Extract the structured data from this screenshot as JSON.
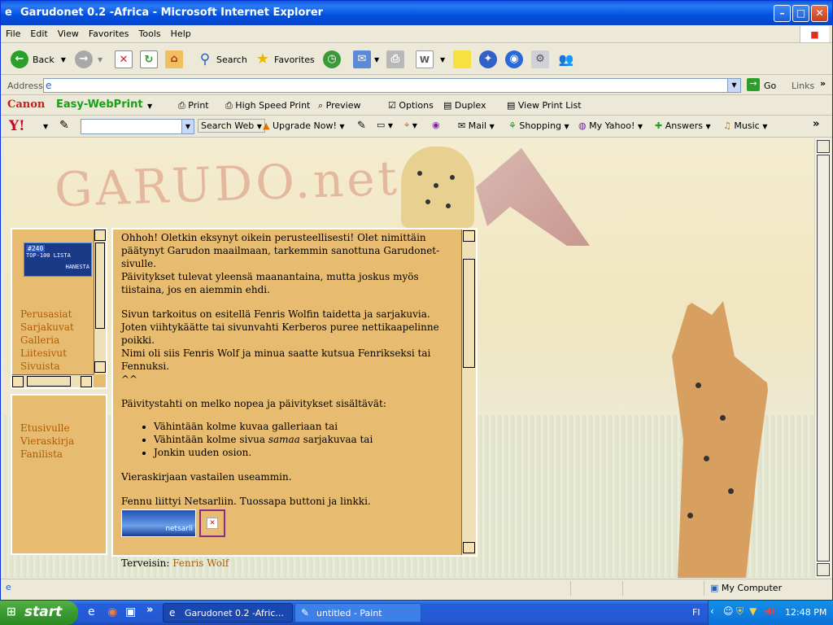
{
  "window": {
    "title": "Garudonet 0.2 -Africa - Microsoft Internet Explorer"
  },
  "menu": [
    "File",
    "Edit",
    "View",
    "Favorites",
    "Tools",
    "Help"
  ],
  "toolbar": {
    "back": "Back",
    "search": "Search",
    "favorites": "Favorites"
  },
  "address": {
    "label": "Address",
    "value": "",
    "go": "Go",
    "links": "Links"
  },
  "canon": {
    "brand": "Canon",
    "product": "Easy-WebPrint",
    "print": "Print",
    "high_speed": "High Speed Print",
    "preview": "Preview",
    "options": "Options",
    "duplex": "Duplex",
    "view_list": "View Print List"
  },
  "yahoo": {
    "logo": "Y!",
    "search_web": "Search Web",
    "upgrade": "Upgrade Now!",
    "mail": "Mail",
    "shopping": "Shopping",
    "my_yahoo": "My Yahoo!",
    "answers": "Answers",
    "music": "Music"
  },
  "page": {
    "banner": "GARUDO.net",
    "top_list": {
      "badge": "#240",
      "line1": "TOP-100 LISTA",
      "line2": "HANESTA"
    },
    "nav1": [
      "Perusasiat",
      "Sarjakuvat",
      "Galleria",
      "Liitesivut",
      "Sivuista"
    ],
    "nav2": [
      "Etusivulle",
      "Vieraskirja",
      "Fanilista"
    ],
    "intro": "Ohhoh! Oletkin eksynyt oikein perusteellisesti! Olet nimittäin päätynyt Garudon maailmaan, tarkemmin sanottuna Garudonet-sivulle.",
    "updates": "Päivitykset tulevat yleensä maanantaina, mutta joskus myös tiistaina, jos en aiemmin ehdi.",
    "purpose": "Sivun tarkoitus on esitellä Fenris Wolfin taidetta ja sarjakuvia. Joten viihtykäätte tai sivunvahti Kerberos puree nettikaapelinne poikki.",
    "name": "Nimi oli siis Fenris Wolf ja minua saatte kutsua Fenrikseksi tai Fennuksi.",
    "smile": "^^",
    "rate": "Päivitystahti on melko nopea ja päivitykset sisältävät:",
    "list": [
      "Vähintään kolme kuvaa galleriaan tai",
      "Vähintään kolme sivua",
      "samaa",
      "sarjakuvaa tai",
      "Jonkin uuden osion."
    ],
    "guestbook": "Vieraskirjaan vastailen useammin.",
    "netsarlj": "Fennu liittyi Netsarliin. Tuossapa buttoni ja linkki.",
    "netsarlj_btn": "netsarli",
    "greet": "Terveisin:",
    "author": "Fenris Wolf"
  },
  "status": {
    "zone": "My Computer"
  },
  "taskbar": {
    "start": "start",
    "task1": "Garudonet 0.2 -Afric...",
    "task2": "untitled - Paint",
    "lang": "FI",
    "time": "12:48 PM"
  }
}
